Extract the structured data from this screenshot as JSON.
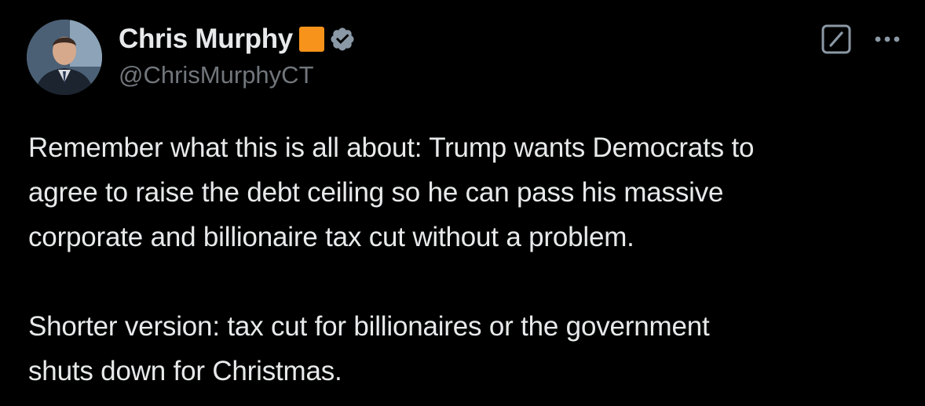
{
  "author": {
    "display_name": "Chris Murphy",
    "handle": "@ChrisMurphyCT",
    "affiliation_badge_color": "#f7931a",
    "verified_badge_color": "#8b98a5",
    "avatar_icon": "profile-photo"
  },
  "actions": {
    "grok_icon": "grok-icon",
    "more_icon": "more-icon"
  },
  "tweet": {
    "paragraph1": [
      "Remember what this is all about: Trump wants Democrats to",
      "agree to raise the debt ceiling so he can pass his massive",
      "corporate and billionaire tax cut without a problem."
    ],
    "paragraph2": [
      "Shorter version: tax cut for billionaires or the government",
      "shuts down for Christmas."
    ]
  },
  "theme": {
    "background": "#000000",
    "text": "#e7e9ea",
    "secondary_text": "#71767b"
  }
}
